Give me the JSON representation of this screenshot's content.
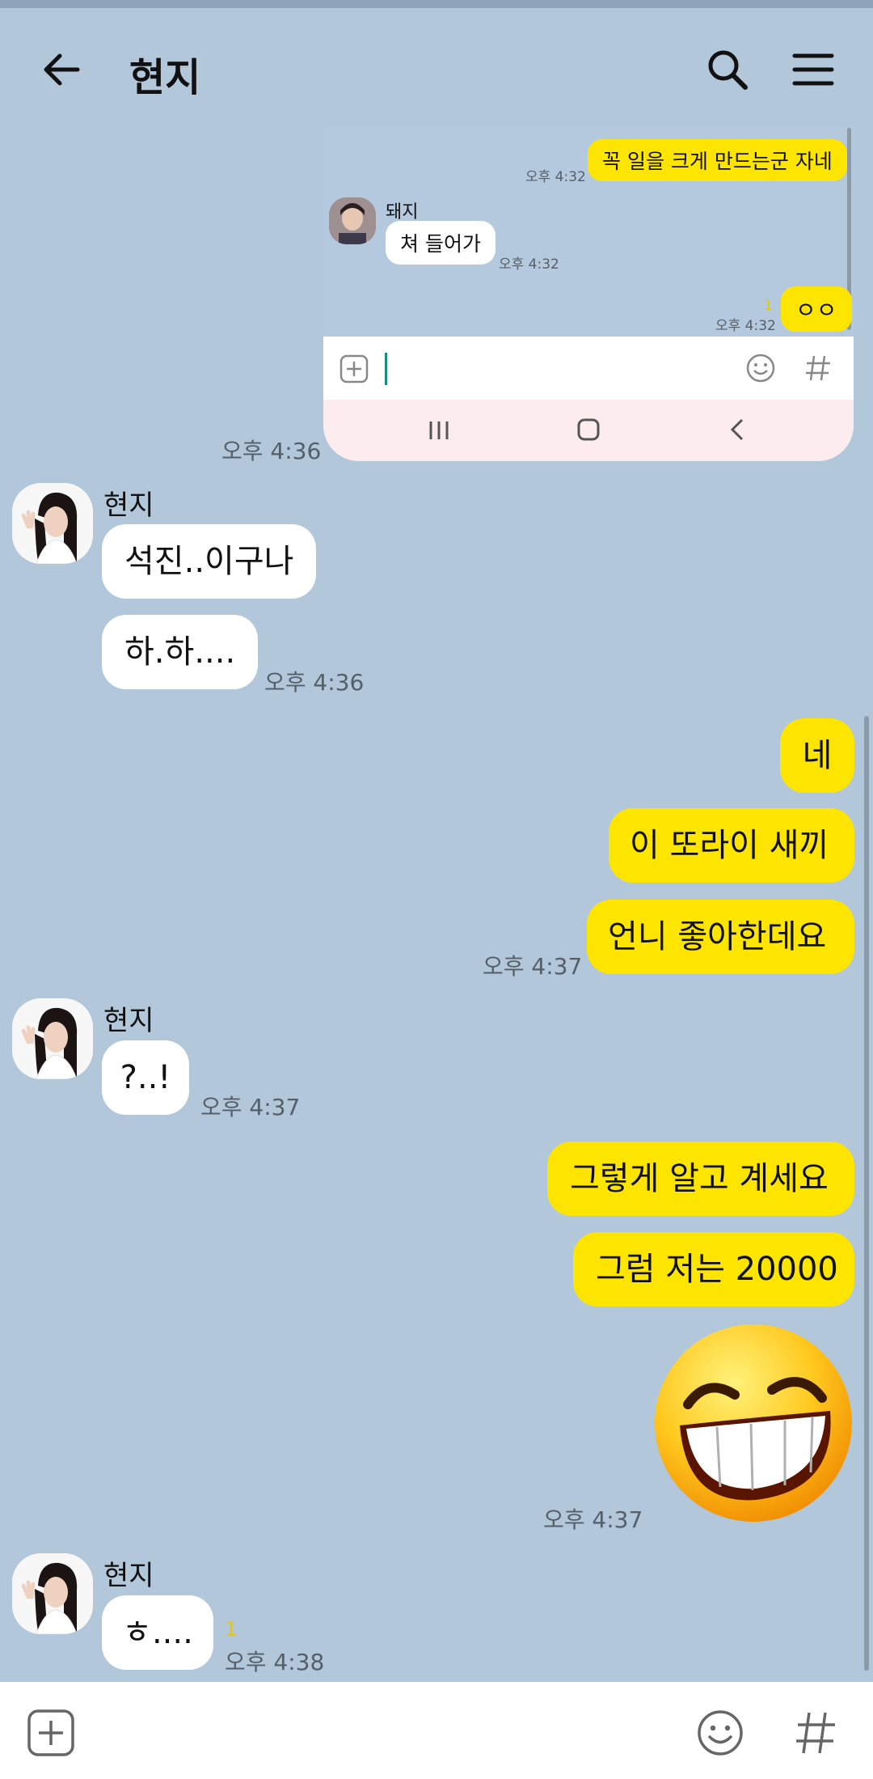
{
  "header": {
    "title": "현지"
  },
  "screenshot": {
    "messages": [
      {
        "text": "꼭 일을 크게 만드는군 자네",
        "time": "오후 4:32"
      },
      {
        "sender": "돼지",
        "text": "쳐 들어가",
        "time": "오후 4:32"
      },
      {
        "text": "ㅇㅇ",
        "time": "오후 4:32",
        "unread": "1"
      }
    ],
    "time_sent": "오후 4:36"
  },
  "messages": {
    "g1": {
      "sender": "현지",
      "m1": "석진..이구나",
      "m2": "하.하....",
      "time": "오후 4:36"
    },
    "g2": {
      "m1": "네",
      "m2": "이 또라이 새끼",
      "m3": "언니 좋아한데요",
      "time": "오후 4:37"
    },
    "g3": {
      "sender": "현지",
      "m1": "?..!",
      "time": "오후 4:37"
    },
    "g4": {
      "m1": "그렇게 알고 계세요",
      "m2": "그럼 저는 20000",
      "time": "오후 4:37"
    },
    "g5": {
      "sender": "현지",
      "m1": "ㅎ....",
      "unread": "1",
      "time": "오후 4:38"
    }
  },
  "colors": {
    "background": "#b2c7da",
    "my_bubble": "#fee500",
    "their_bubble": "#ffffff"
  },
  "icons": [
    "back-arrow-icon",
    "search-icon",
    "menu-icon",
    "plus-icon",
    "emoji-icon",
    "hashtag-icon",
    "laughing-emoji-icon"
  ]
}
